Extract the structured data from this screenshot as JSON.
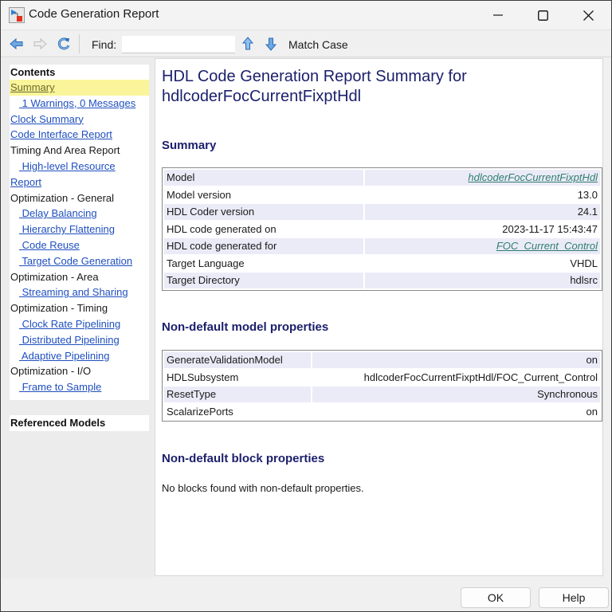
{
  "window": {
    "title": "Code Generation Report",
    "app_icon": "simulink-model-icon",
    "controls": [
      "minimize",
      "maximize",
      "close"
    ]
  },
  "toolbar": {
    "back_icon": "back-arrow-icon",
    "forward_icon": "forward-arrow-icon",
    "refresh_icon": "refresh-icon",
    "find_label": "Find:",
    "find_value": "",
    "find_placeholder": "",
    "find_prev_icon": "arrow-up-icon",
    "find_next_icon": "arrow-down-icon",
    "match_case_label": "Match Case"
  },
  "sidebar": {
    "header": "Contents",
    "items": [
      {
        "label": "Summary",
        "type": "link",
        "indent": false,
        "active": true
      },
      {
        "label": " 1 Warnings, 0 Messages",
        "type": "link",
        "indent": true,
        "active": false
      },
      {
        "label": "Clock Summary",
        "type": "link",
        "indent": false,
        "active": false
      },
      {
        "label": "Code Interface Report",
        "type": "link",
        "indent": false,
        "active": false
      },
      {
        "label": "Timing And Area Report",
        "type": "heading",
        "indent": false,
        "active": false
      },
      {
        "label": " High-level Resource",
        "type": "link",
        "indent": true,
        "active": false
      },
      {
        "label": "Report",
        "type": "link",
        "indent": false,
        "active": false
      },
      {
        "label": "Optimization - General",
        "type": "heading",
        "indent": false,
        "active": false
      },
      {
        "label": " Delay Balancing",
        "type": "link",
        "indent": true,
        "active": false
      },
      {
        "label": " Hierarchy Flattening",
        "type": "link",
        "indent": true,
        "active": false
      },
      {
        "label": " Code Reuse",
        "type": "link",
        "indent": true,
        "active": false
      },
      {
        "label": " Target Code Generation",
        "type": "link",
        "indent": true,
        "active": false
      },
      {
        "label": "Optimization - Area",
        "type": "heading",
        "indent": false,
        "active": false
      },
      {
        "label": " Streaming and Sharing",
        "type": "link",
        "indent": true,
        "active": false
      },
      {
        "label": "Optimization - Timing",
        "type": "heading",
        "indent": false,
        "active": false
      },
      {
        "label": " Clock Rate Pipelining",
        "type": "link",
        "indent": true,
        "active": false
      },
      {
        "label": " Distributed Pipelining",
        "type": "link",
        "indent": true,
        "active": false
      },
      {
        "label": " Adaptive Pipelining",
        "type": "link",
        "indent": true,
        "active": false
      },
      {
        "label": "Optimization - I/O",
        "type": "heading",
        "indent": false,
        "active": false
      },
      {
        "label": " Frame to Sample",
        "type": "link",
        "indent": true,
        "active": false
      }
    ],
    "referenced_models": "Referenced Models"
  },
  "content": {
    "title": "HDL Code Generation Report Summary for hdlcoderFocCurrentFixptHdl",
    "summary_heading": "Summary",
    "summary_rows": [
      {
        "key": "Model",
        "value": "hdlcoderFocCurrentFixptHdl",
        "link": true
      },
      {
        "key": "Model version",
        "value": "13.0",
        "link": false
      },
      {
        "key": "HDL Coder version",
        "value": "24.1",
        "link": false
      },
      {
        "key": "HDL code generated on",
        "value": "2023-11-17 15:43:47",
        "link": false
      },
      {
        "key": "HDL code generated for",
        "value": "FOC_Current_Control",
        "link": true
      },
      {
        "key": "Target Language",
        "value": "VHDL",
        "link": false
      },
      {
        "key": "Target Directory",
        "value": "hdlsrc",
        "link": false
      }
    ],
    "model_props_heading": "Non-default model properties",
    "model_props_rows": [
      {
        "key": "GenerateValidationModel",
        "value": "on"
      },
      {
        "key": "HDLSubsystem",
        "value": "hdlcoderFocCurrentFixptHdl/FOC_Current_Control"
      },
      {
        "key": "ResetType",
        "value": "Synchronous"
      },
      {
        "key": "ScalarizePorts",
        "value": "on"
      }
    ],
    "block_props_heading": "Non-default block properties",
    "block_props_text": "No blocks found with non-default properties."
  },
  "footer": {
    "ok_label": "OK",
    "help_label": "Help"
  },
  "colors": {
    "heading": "#1b1f6b",
    "link": "#1f4fbf",
    "table_link": "#2f7d6f",
    "active_highlight": "#faf59a",
    "row_stripe": "#ebebf8"
  }
}
